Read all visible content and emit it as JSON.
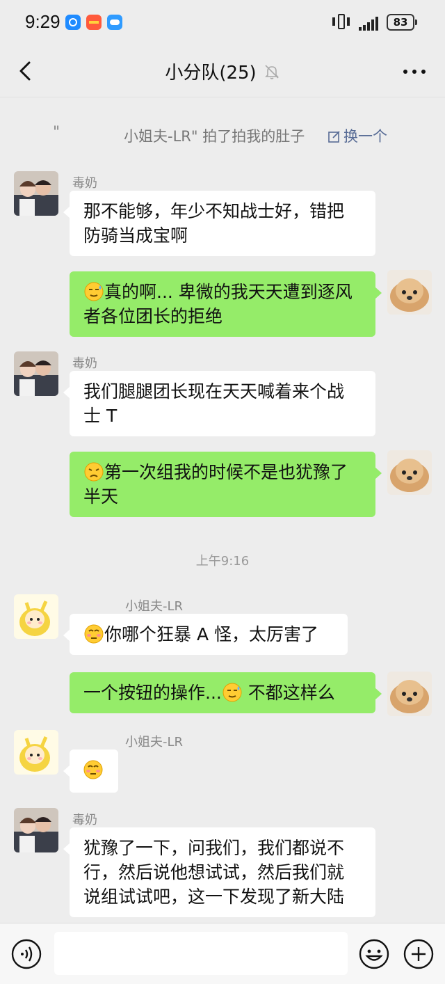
{
  "status_bar": {
    "time": "9:29",
    "battery": "83"
  },
  "header": {
    "title": "小分队(25)"
  },
  "system_message": {
    "quote": "\"",
    "text": "小姐夫-LR\" 拍了拍我的肚子",
    "action": "换一个"
  },
  "messages": [
    {
      "side": "left",
      "sender": "毒奶",
      "lines": [
        "那不能够，年少不知战士好，错把",
        "防骑当成宝啊"
      ]
    },
    {
      "side": "right",
      "emoji": "sweat-smile-emoji",
      "lines": [
        "真的啊... 卑微的我天天遭到逐风",
        "者各位团长的拒绝"
      ]
    },
    {
      "side": "left",
      "sender": "毒奶",
      "lines": [
        "我们腿腿团长现在天天喊着来个战",
        "士 T"
      ]
    },
    {
      "side": "right",
      "emoji": "frown-emoji",
      "lines": [
        "第一次组我的时候不是也犹豫了",
        "半天"
      ]
    },
    {
      "side": "left",
      "sender": "小姐夫-LR",
      "emoji": "flushed-emoji",
      "lines": [
        "你哪个狂暴 A 怪，太厉害了"
      ]
    },
    {
      "side": "right",
      "lines": [
        "一个按钮的操作...",
        " 不都这样么"
      ]
    },
    {
      "side": "left",
      "sender": "小姐夫-LR",
      "emoji": "flushed-emoji",
      "lines": []
    },
    {
      "side": "left",
      "sender": "毒奶",
      "lines": [
        "犹豫了一下，问我们，我们都说不",
        "行，然后说他想试试，然后我们就",
        "说组试试吧，这一下发现了新大陆"
      ]
    }
  ],
  "timestamp": "上午9:16",
  "icons": {
    "back": "back-arrow-icon",
    "mute": "mute-bell-icon",
    "more": "more-dots-icon",
    "voice": "voice-icon",
    "emoji": "emoji-icon",
    "plus": "plus-icon"
  },
  "colors": {
    "background": "#ededed",
    "bubble_self": "#95ec69",
    "bubble_other": "#ffffff",
    "link": "#576b95"
  }
}
